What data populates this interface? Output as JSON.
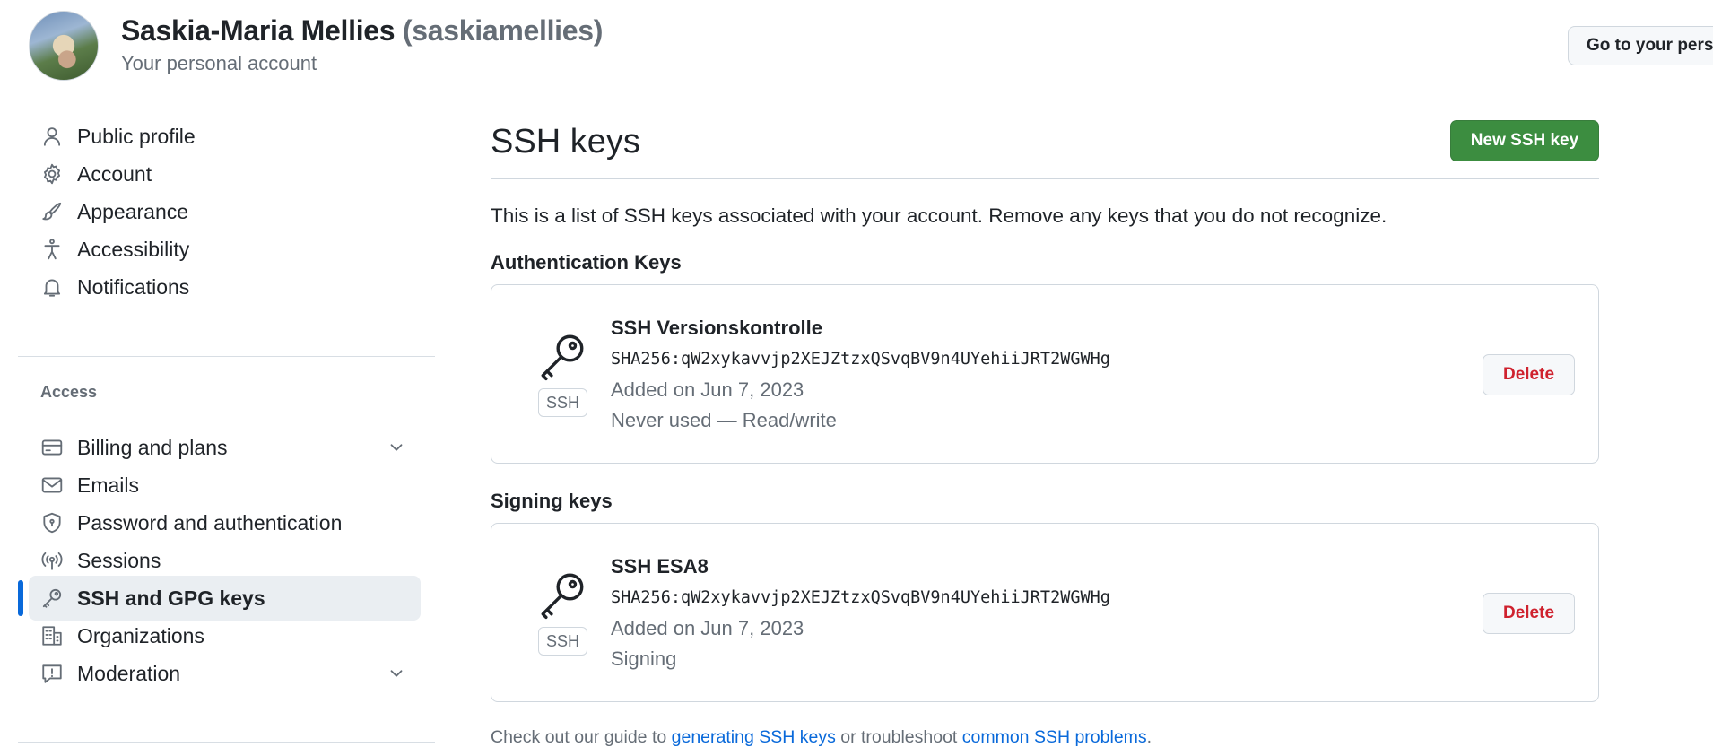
{
  "header": {
    "display_name": "Saskia-Maria Mellies",
    "username": "(saskiamellies)",
    "subtitle": "Your personal account",
    "go_button": "Go to your pers"
  },
  "sidebar": {
    "items_top": [
      {
        "label": "Public profile",
        "icon": "person-icon"
      },
      {
        "label": "Account",
        "icon": "gear-icon"
      },
      {
        "label": "Appearance",
        "icon": "paintbrush-icon"
      },
      {
        "label": "Accessibility",
        "icon": "accessibility-icon"
      },
      {
        "label": "Notifications",
        "icon": "bell-icon"
      }
    ],
    "section_access": "Access",
    "items_access": [
      {
        "label": "Billing and plans",
        "icon": "credit-card-icon",
        "expandable": true
      },
      {
        "label": "Emails",
        "icon": "mail-icon"
      },
      {
        "label": "Password and authentication",
        "icon": "shield-icon"
      },
      {
        "label": "Sessions",
        "icon": "broadcast-icon"
      },
      {
        "label": "SSH and GPG keys",
        "icon": "key-icon",
        "active": true
      },
      {
        "label": "Organizations",
        "icon": "organization-icon"
      },
      {
        "label": "Moderation",
        "icon": "report-icon",
        "expandable": true
      }
    ]
  },
  "main": {
    "title": "SSH keys",
    "new_button": "New SSH key",
    "intro": "This is a list of SSH keys associated with your account. Remove any keys that you do not recognize.",
    "auth_heading": "Authentication Keys",
    "signing_heading": "Signing keys",
    "auth_keys": [
      {
        "badge": "SSH",
        "title": "SSH Versionskontrolle",
        "fingerprint": "SHA256:qW2xykavvjp2XEJZtzxQSvqBV9n4UYehiiJRT2WGWHg",
        "added": "Added on Jun 7, 2023",
        "usage": "Never used — Read/write",
        "delete": "Delete"
      }
    ],
    "signing_keys": [
      {
        "badge": "SSH",
        "title": "SSH ESA8",
        "fingerprint": "SHA256:qW2xykavvjp2XEJZtzxQSvqBV9n4UYehiiJRT2WGWHg",
        "added": "Added on Jun 7, 2023",
        "usage": "Signing",
        "delete": "Delete"
      }
    ],
    "footer": {
      "prefix": "Check out our guide to ",
      "link1": "generating SSH keys",
      "middle": " or troubleshoot ",
      "link2": "common SSH problems",
      "suffix": "."
    }
  },
  "colors": {
    "accent": "#0969da",
    "primary_button": "#3c8d40",
    "danger": "#cf222e",
    "muted": "#656d76"
  }
}
